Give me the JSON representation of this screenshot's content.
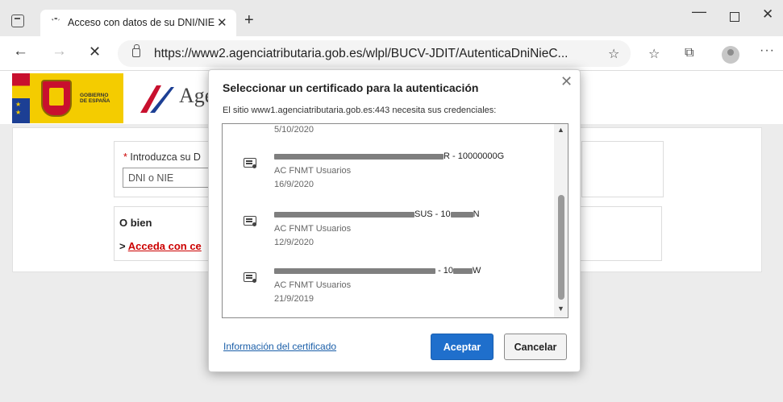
{
  "browser": {
    "tab_title": "Acceso con datos de su DNI/NIE",
    "url": "https://www2.agenciatributaria.gob.es/wlpl/BUCV-JDIT/AutenticaDniNieC..."
  },
  "page": {
    "gov_line1": "GOBIERNO",
    "gov_line2": "DE ESPAÑA",
    "agency_text": "Age",
    "dni_label": "Introduzca su D",
    "dni_placeholder": "DNI o NIE",
    "alt_title": "O bien",
    "alt_link": "Acceda con ce"
  },
  "dialog": {
    "title": "Seleccionar un certificado para la autenticación",
    "subtitle": "El sitio www1.agenciatributaria.gob.es:443 necesita sus credenciales:",
    "partial_date": "5/10/2020",
    "certificates": [
      {
        "name_suffix": "R - 10000000G",
        "issuer": "AC FNMT Usuarios",
        "date": "16/9/2020"
      },
      {
        "name_suffix": "SUS - 10",
        "name_end": "N",
        "issuer": "AC FNMT Usuarios",
        "date": "12/9/2020"
      },
      {
        "name_suffix": "- 10",
        "name_end": "W",
        "issuer": "AC FNMT Usuarios",
        "date": "21/9/2019"
      }
    ],
    "info_link": "Información del certificado",
    "ok_label": "Aceptar",
    "cancel_label": "Cancelar"
  }
}
